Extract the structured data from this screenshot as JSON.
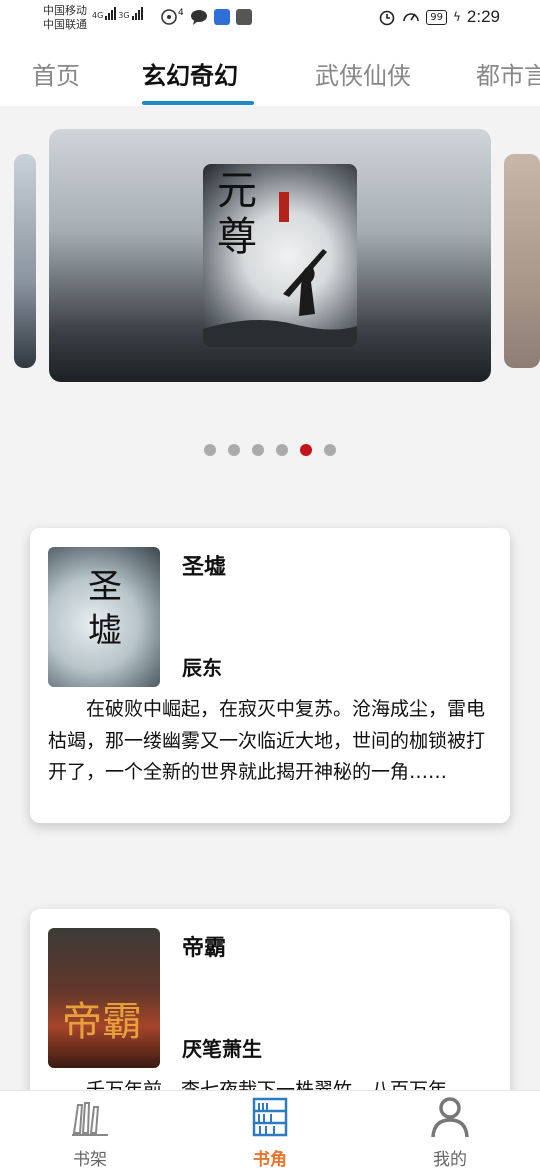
{
  "status_bar": {
    "carrier1": "中国移动",
    "carrier2": "中国联通",
    "net1": "4G",
    "net2": "3G",
    "wifi_sub": "4",
    "battery": "99",
    "time": "2:29"
  },
  "tabs": [
    {
      "label": "首页",
      "active": false
    },
    {
      "label": "玄幻奇幻",
      "active": true
    },
    {
      "label": "武侠仙侠",
      "active": false
    },
    {
      "label": "都市言",
      "active": false
    }
  ],
  "banner": {
    "cover_title": "元尊",
    "dots_count": 6,
    "active_dot": 5
  },
  "books": [
    {
      "title": "圣墟",
      "author": "辰东",
      "cover_text": "圣墟",
      "description": "在破败中崛起，在寂灭中复苏。沧海成尘，雷电枯竭，那一缕幽雾又一次临近大地，世间的枷锁被打开了，一个全新的世界就此揭开神秘的一角……"
    },
    {
      "title": "帝霸",
      "author": "厌笔萧生",
      "cover_text": "帝霸",
      "description": "千万年前，李七夜栽下一株翠竹。八百万年"
    }
  ],
  "bottom_nav": [
    {
      "label": "书架",
      "icon": "bookshelf-icon",
      "active": false
    },
    {
      "label": "书角",
      "icon": "bookstore-icon",
      "active": true
    },
    {
      "label": "我的",
      "icon": "profile-icon",
      "active": false
    }
  ],
  "colors": {
    "accent_tab": "#1e8bc3",
    "active_dot": "#c4131a",
    "active_nav": "#e9742b"
  }
}
